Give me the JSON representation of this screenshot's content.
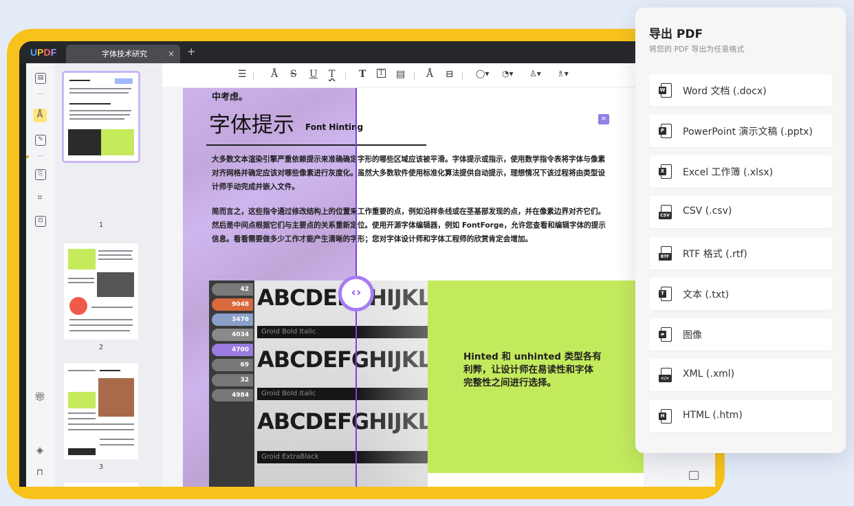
{
  "app": {
    "logo": [
      "U",
      "P",
      "D",
      "F"
    ],
    "tab_title": "字体技术研究",
    "tab_close": "×",
    "tab_add": "+"
  },
  "toolbar": {
    "icons": [
      "comment-icon",
      "highlight-icon",
      "strikethrough-icon",
      "underline-icon",
      "squiggly-underline-icon",
      "text-icon",
      "textbox-icon",
      "callout-icon",
      "pencil-icon",
      "eraser-icon",
      "shape-icon",
      "stamp-icon",
      "user-icon",
      "pen-icon"
    ],
    "glyphs": [
      "☰",
      "Å",
      "S",
      "U",
      "T",
      "T",
      "T",
      "▤",
      "Å",
      "⊟",
      "◯▾",
      "◔▾",
      "♙▾",
      "♗▾"
    ]
  },
  "thumbnails": [
    {
      "number": "1"
    },
    {
      "number": "2"
    },
    {
      "number": "3"
    }
  ],
  "document": {
    "top_line": "中考虑。",
    "heading": "字体提示",
    "heading_en": "Font Hinting",
    "para1": [
      "大多数文本渲染引擎严重依赖提示来准确确定字形的哪些区域应该被平滑。字体提示或指示，使用数学指令表将字体与像素",
      "对齐网格并确定应该对哪些像素进行灰度化。虽然大多数软件使用标准化算法提供自动提示，理想情况下该过程将由类型设",
      "计师手动完成并嵌入文件。"
    ],
    "para2": [
      "简而言之，这些指令通过修改结构上的位置来工作重要的点，例如沿样条线或在茎基部发现的点，并在像素边界对齐它们。",
      "然后是中间点根据它们与主要点的关系重新定位。使用开源字体编辑器，例如 FontForge，允许您查看和编辑字体的提示",
      "信息。看看需要做多少工作才能产生清晰的字形；您对字体设计师和字体工程师的欣赏肯定会增加。"
    ],
    "photo_rows": [
      {
        "text": "ABCDEFGHIJKLMNC",
        "label": "Groid Bold Italic"
      },
      {
        "text": "ABCDEFGHIJKLMNC",
        "label": "Groid Bold Italic"
      },
      {
        "text": "ABCDEFGHIJKLMNC",
        "label": "Groid ExtraBlack"
      }
    ],
    "tags": [
      "42",
      "9048",
      "3476",
      "4034",
      "4700",
      "69",
      "32",
      "4984"
    ],
    "callout_lines": [
      "Hinted 和 unhinted 类型各有",
      "利弊，让设计师在易读性和字体",
      "完整性之间进行选择。"
    ]
  },
  "export_panel": {
    "title": "导出 PDF",
    "subtitle": "将您的 PDF 导出为任意格式",
    "options": [
      {
        "label": "Word 文档 (.docx)",
        "icon": "word-icon",
        "badge": "W"
      },
      {
        "label": "PowerPoint 演示文稿 (.pptx)",
        "icon": "powerpoint-icon",
        "badge": "P"
      },
      {
        "label": "Excel 工作簿 (.xlsx)",
        "icon": "excel-icon",
        "badge": "X"
      },
      {
        "label": "CSV (.csv)",
        "icon": "csv-icon",
        "badge": "CSV"
      },
      {
        "label": "RTF 格式 (.rtf)",
        "icon": "rtf-icon",
        "badge": "RTF"
      },
      {
        "label": "文本 (.txt)",
        "icon": "text-file-icon",
        "badge": "T"
      },
      {
        "label": "图像",
        "icon": "image-icon",
        "badge": "▰"
      },
      {
        "label": "XML (.xml)",
        "icon": "xml-icon",
        "badge": "</>"
      },
      {
        "label": "HTML (.htm)",
        "icon": "html-icon",
        "badge": "H"
      }
    ]
  },
  "colors": {
    "frame": "#f7c21a",
    "accent_purple": "#7b3fe4",
    "callout_green": "#c3ea5c"
  }
}
